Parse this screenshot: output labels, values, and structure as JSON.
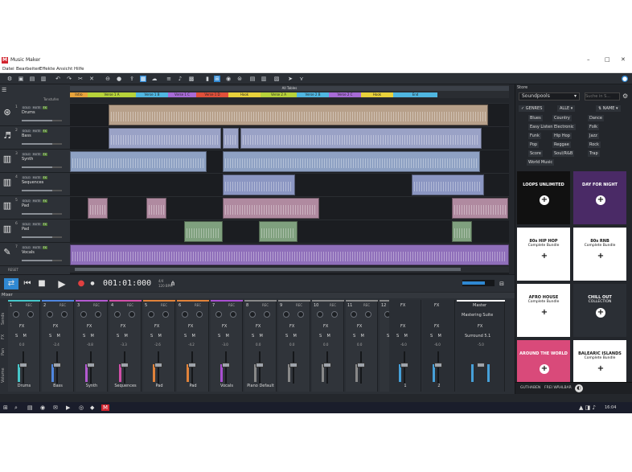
{
  "window": {
    "title": "Music Maker",
    "logo": "M",
    "minimize": "–",
    "maximize": "□",
    "close": "✕"
  },
  "menu": [
    "Datei",
    "Bearbeiten",
    "Effekte",
    "Ansicht",
    "Hilfe"
  ],
  "arranger": {
    "ruler_label": "Tonstufen",
    "song_title": "All Tables",
    "segments": [
      {
        "label": "Intro",
        "color": "#e8a33b"
      },
      {
        "label": "Verse 1 A",
        "color": "#b6d23a"
      },
      {
        "label": "Verse 1 B",
        "color": "#4fb6e0"
      },
      {
        "label": "Verse 1 C",
        "color": "#a76bd6"
      },
      {
        "label": "Verse 1 D",
        "color": "#e04f3a"
      },
      {
        "label": "Hook",
        "color": "#e8d13b"
      },
      {
        "label": "Verse 2 A",
        "color": "#b6d23a"
      },
      {
        "label": "Verse 2 B",
        "color": "#4fb6e0"
      },
      {
        "label": "Verse 2 C",
        "color": "#a76bd6"
      },
      {
        "label": "Hook",
        "color": "#e8d13b"
      },
      {
        "label": "End",
        "color": "#4fb6e0"
      }
    ],
    "tracks": [
      {
        "num": "1",
        "name": "Drums",
        "icon": "drum-icon"
      },
      {
        "num": "2",
        "name": "Bass",
        "icon": "guitar-icon"
      },
      {
        "num": "3",
        "name": "Synth",
        "icon": "keyboard-icon"
      },
      {
        "num": "4",
        "name": "Sequences",
        "icon": "keyboard-icon"
      },
      {
        "num": "5",
        "name": "Pad",
        "icon": "keyboard-icon"
      },
      {
        "num": "6",
        "name": "Pad",
        "icon": "keyboard-icon"
      },
      {
        "num": "7",
        "name": "Vocals",
        "icon": "mic-icon"
      }
    ],
    "track_buttons": [
      "SOLO",
      "MUTE",
      "FX"
    ],
    "reset": "RESET"
  },
  "transport": {
    "timecode": "001:01:000",
    "tempo": "120",
    "tempo_unit": "BPM",
    "signature": "4/4"
  },
  "mixer": {
    "title": "Mixer",
    "side_labels": [
      "Sends",
      "FX",
      "Pan",
      "Volume"
    ],
    "channels": [
      {
        "num": "1",
        "name": "Drums",
        "val": "0.0",
        "color": "#46c6c9"
      },
      {
        "num": "2",
        "name": "Bass",
        "val": "-2.4",
        "color": "#4f86e0"
      },
      {
        "num": "3",
        "name": "Synth",
        "val": "-0.8",
        "color": "#b35ad1"
      },
      {
        "num": "4",
        "name": "Sequences",
        "val": "-3.3",
        "color": "#d14fa8"
      },
      {
        "num": "5",
        "name": "Pad",
        "val": "-2.6",
        "color": "#e0823a"
      },
      {
        "num": "6",
        "name": "Pad",
        "val": "-4.2",
        "color": "#e0823a"
      },
      {
        "num": "7",
        "name": "Vocals",
        "val": "-3.0",
        "color": "#a94fd1"
      },
      {
        "num": "8",
        "name": "Piano Default",
        "val": "0.0",
        "color": "#888888"
      },
      {
        "num": "9",
        "name": "",
        "val": "0.0",
        "color": "#888888"
      },
      {
        "num": "10",
        "name": "",
        "val": "0.0",
        "color": "#888888"
      },
      {
        "num": "11",
        "name": "",
        "val": "0.0",
        "color": "#888888"
      },
      {
        "num": "12",
        "name": "",
        "val": "0.0",
        "color": "#888888"
      }
    ],
    "fx_channels": [
      {
        "name": "FX",
        "num": "1",
        "val": "-6.0"
      },
      {
        "name": "FX",
        "num": "2",
        "val": "-6.0"
      }
    ],
    "master": {
      "name": "Master",
      "suite": "Mastering Suite",
      "fx": "FX",
      "surround": "Surround 5.1",
      "val": "-5.0"
    },
    "rec": "REC",
    "fx": "FX",
    "solo": "S",
    "mute": "M"
  },
  "store": {
    "title": "Store",
    "dropdown": "Soundpools",
    "search_placeholder": "Suche in S...",
    "filter_genres": "GENRES",
    "filter_all": "ALLE",
    "filter_name": "NAME",
    "genres": [
      "Blues",
      "Country",
      "Dance",
      "Easy Listening",
      "Electronic",
      "Folk",
      "Funk",
      "Hip Hop",
      "Jazz",
      "Pop",
      "Reggae",
      "Rock",
      "Score",
      "Soul/R&B",
      "Trap",
      "Various",
      "World Music"
    ],
    "tiles": [
      {
        "t1": "LOOPS UNLIMITED",
        "t2": "",
        "bg": "#111111"
      },
      {
        "t1": "DAY FOR NIGHT",
        "t2": "",
        "bg": "#4a2a66"
      },
      {
        "t1": "80s HIP HOP",
        "t2": "Complete Bundle",
        "bg": "#ffffff"
      },
      {
        "t1": "80s RNB",
        "t2": "Complete Bundle",
        "bg": "#ffffff"
      },
      {
        "t1": "AFRO HOUSE",
        "t2": "Complete Bundle",
        "bg": "#ffffff"
      },
      {
        "t1": "CHILL OUT",
        "t2": "COLLECTION",
        "bg": "#2b2f35"
      },
      {
        "t1": "AROUND THE WORLD",
        "t2": "",
        "bg": "#d94a7a"
      },
      {
        "t1": "BALEARIC ISLANDS",
        "t2": "Complete Bundle",
        "bg": "#ffffff"
      }
    ],
    "footer_left": "GUTHABEN",
    "footer_right": "FREI WÄHLBAR"
  },
  "taskbar": {
    "time": "16:04"
  }
}
